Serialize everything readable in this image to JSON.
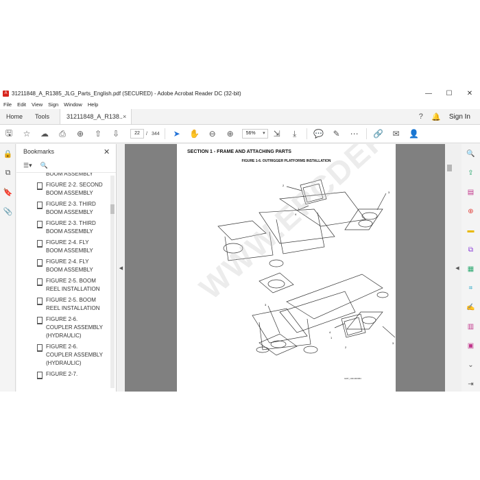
{
  "window": {
    "title": "31211848_A_R1385_JLG_Parts_English.pdf (SECURED) - Adobe Acrobat Reader DC (32-bit)",
    "minimize": "—",
    "maximize": "☐",
    "close": "✕"
  },
  "menu": [
    "File",
    "Edit",
    "View",
    "Sign",
    "Window",
    "Help"
  ],
  "tabs": {
    "home": "Home",
    "tools": "Tools",
    "document": "31211848_A_R138...",
    "close": "×",
    "signin": "Sign In"
  },
  "toolbar": {
    "page_current": "22",
    "page_separator": "/",
    "page_total": "344",
    "zoom": "56%"
  },
  "bookmarks": {
    "title": "Bookmarks",
    "items": [
      "BOOM ASSEMBLY",
      "FIGURE 2-2. SECOND BOOM ASSEMBLY",
      "FIGURE 2-3. THIRD BOOM ASSEMBLY",
      "FIGURE 2-3. THIRD BOOM ASSEMBLY",
      "FIGURE 2-4. FLY BOOM ASSEMBLY",
      "FIGURE 2-4. FLY BOOM ASSEMBLY",
      "FIGURE 2-5. BOOM REEL INSTALLATION",
      "FIGURE 2-5. BOOM REEL INSTALLATION",
      "FIGURE 2-6. COUPLER ASSEMBLY (HYDRAULIC)",
      "FIGURE 2-6. COUPLER ASSEMBLY (HYDRAULIC)",
      "FIGURE 2-7."
    ]
  },
  "page": {
    "section": "SECTION 1 - FRAME AND ATTACHING PARTS",
    "figure": "FIGURE 1-6. OUTRIGGER PLATFORMS INSTALLATION",
    "drawing_code": "GRP_1001000684",
    "watermark": "WWW.EPCDEPO.COM",
    "callouts": [
      "2",
      "3",
      "4",
      "1",
      "3",
      "4",
      "1",
      "2",
      "3"
    ]
  },
  "colors": {
    "acrobat_red": "#d7251d",
    "accent_blue": "#2473d8"
  }
}
